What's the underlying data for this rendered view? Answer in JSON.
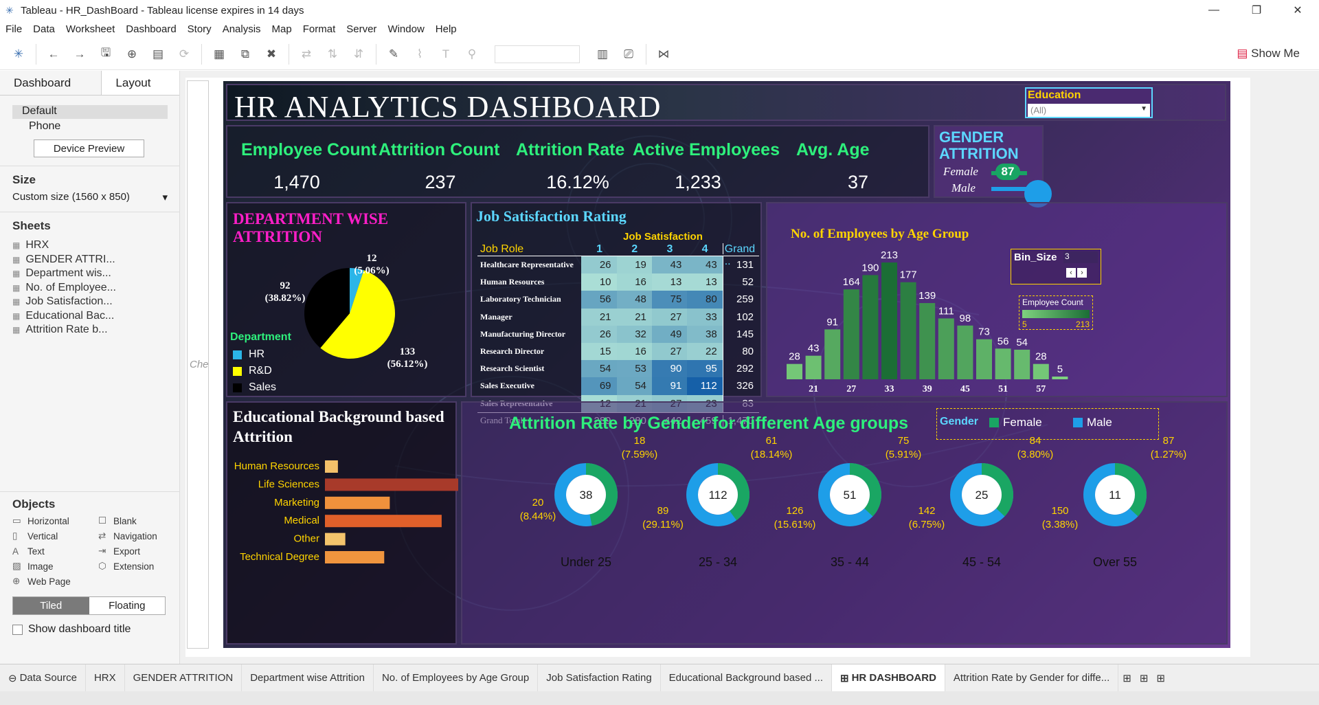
{
  "window": {
    "title": "Tableau - HR_DashBoard - Tableau license expires in 14 days"
  },
  "menu": [
    "File",
    "Data",
    "Worksheet",
    "Dashboard",
    "Story",
    "Analysis",
    "Map",
    "Format",
    "Server",
    "Window",
    "Help"
  ],
  "toolbar": {
    "show_me": "Show Me"
  },
  "sidebar": {
    "tabs": [
      "Dashboard",
      "Layout"
    ],
    "devices": [
      "Default",
      "Phone"
    ],
    "device_preview": "Device Preview",
    "size_label": "Size",
    "size_value": "Custom size (1560 x 850)",
    "sheets_label": "Sheets",
    "sheets": [
      "HRX",
      "GENDER ATTRI...",
      "Department wis...",
      "No. of Employee...",
      "Job Satisfaction...",
      "Educational Bac...",
      "Attrition Rate b..."
    ],
    "objects_label": "Objects",
    "objects": [
      "Horizontal",
      "Blank",
      "Vertical",
      "Navigation",
      "Text",
      "Export",
      "Image",
      "Extension",
      "Web Page"
    ],
    "tiled": "Tiled",
    "floating": "Floating",
    "show_title": "Show dashboard title"
  },
  "canvas_side_text": "Che",
  "dashboard": {
    "title": "HR ANALYTICS DASHBOARD",
    "filter": {
      "label": "Education",
      "value": "(All)"
    },
    "kpis": [
      {
        "label": "Employee Count",
        "value": "1,470"
      },
      {
        "label": "Attrition Count",
        "value": "237"
      },
      {
        "label": "Attrition Rate",
        "value": "16.12%"
      },
      {
        "label": "Active Employees",
        "value": "1,233"
      },
      {
        "label": "Avg. Age",
        "value": "37"
      }
    ],
    "gender_attrition": {
      "title_line1": "GENDER",
      "title_line2": "ATTRITION",
      "female_label": "Female",
      "male_label": "Male",
      "female_value": "87"
    },
    "department": {
      "title_line1": "DEPARTMENT WISE",
      "title_line2": "ATTRITION",
      "legend_title": "Department",
      "legend": [
        "HR",
        "R&D",
        "Sales"
      ],
      "labels": [
        {
          "v": "12",
          "p": "(5.06%)"
        },
        {
          "v": "133",
          "p": "(56.12%)"
        },
        {
          "v": "92",
          "p": "(38.82%)"
        }
      ]
    },
    "job_satisfaction": {
      "title": "Job Satisfaction Rating",
      "col_group": "Job Satisfaction",
      "row_header": "Job Role",
      "cols": [
        "1",
        "2",
        "3",
        "4",
        "Grand .."
      ],
      "rows": [
        {
          "role": "Healthcare Representative",
          "v": [
            "26",
            "19",
            "43",
            "43",
            "131"
          ]
        },
        {
          "role": "Human Resources",
          "v": [
            "10",
            "16",
            "13",
            "13",
            "52"
          ]
        },
        {
          "role": "Laboratory Technician",
          "v": [
            "56",
            "48",
            "75",
            "80",
            "259"
          ]
        },
        {
          "role": "Manager",
          "v": [
            "21",
            "21",
            "27",
            "33",
            "102"
          ]
        },
        {
          "role": "Manufacturing Director",
          "v": [
            "26",
            "32",
            "49",
            "38",
            "145"
          ]
        },
        {
          "role": "Research Director",
          "v": [
            "15",
            "16",
            "27",
            "22",
            "80"
          ]
        },
        {
          "role": "Research Scientist",
          "v": [
            "54",
            "53",
            "90",
            "95",
            "292"
          ]
        },
        {
          "role": "Sales Executive",
          "v": [
            "69",
            "54",
            "91",
            "112",
            "326"
          ]
        },
        {
          "role": "Sales Representative",
          "v": [
            "12",
            "21",
            "27",
            "23",
            "83"
          ]
        }
      ],
      "total": {
        "role": "Grand Total",
        "v": [
          "289",
          "280",
          "442",
          "459",
          "1,470"
        ]
      }
    },
    "age_group": {
      "title": "No. of Employees by Age Group",
      "bin_label": "Bin_Size",
      "bin_value": "3",
      "legend_title": "Employee Count",
      "legend_min": "5",
      "legend_max": "213"
    },
    "education": {
      "title_line1": "Educational Background based",
      "title_line2": "Attrition"
    },
    "gender_age": {
      "title": "Attrition Rate by Gender for different Age groups",
      "legend_title": "Gender",
      "legend": [
        "Female",
        "Male"
      ]
    }
  },
  "chart_data": [
    {
      "type": "pie",
      "title": "DEPARTMENT WISE ATTRITION",
      "categories": [
        "HR",
        "R&D",
        "Sales"
      ],
      "values": [
        12,
        133,
        92
      ],
      "percent": [
        5.06,
        56.12,
        38.82
      ],
      "colors": [
        "#2bb5e8",
        "#ffff00",
        "#000000"
      ]
    },
    {
      "type": "bar",
      "title": "No. of Employees by Age Group",
      "x": [
        "18",
        "21",
        "24",
        "27",
        "30",
        "33",
        "36",
        "39",
        "42",
        "45",
        "48",
        "51",
        "54",
        "57",
        "60"
      ],
      "values": [
        28,
        43,
        91,
        164,
        190,
        213,
        177,
        139,
        111,
        98,
        73,
        56,
        54,
        28,
        5
      ],
      "tick_labels": [
        "21",
        "27",
        "33",
        "39",
        "45",
        "51",
        "57"
      ],
      "ylim": [
        0,
        213
      ]
    },
    {
      "type": "bar",
      "title": "Educational Background based Attrition",
      "categories": [
        "Human Resources",
        "Life Sciences",
        "Marketing",
        "Medical",
        "Other",
        "Technical Degree"
      ],
      "values": [
        7,
        89,
        35,
        63,
        11,
        32
      ]
    },
    {
      "type": "pie",
      "title": "Attrition Rate by Gender for different Age groups",
      "groups": [
        {
          "age": "Under 25",
          "total": "38",
          "male": {
            "v": "20",
            "p": "(8.44%)"
          },
          "female": {
            "v": "18",
            "p": "(7.59%)"
          },
          "male_share": 0.53
        },
        {
          "age": "25 - 34",
          "total": "112",
          "male": {
            "v": "89",
            "p": "(29.11%)"
          },
          "female": {
            "v": "61",
            "p": "(18.14%)"
          },
          "male_share": 0.6
        },
        {
          "age": "35 - 44",
          "total": "51",
          "male": {
            "v": "126",
            "p": "(15.61%)"
          },
          "female": {
            "v": "75",
            "p": "(5.91%)"
          },
          "male_share": 0.63
        },
        {
          "age": "45 - 54",
          "total": "25",
          "male": {
            "v": "142",
            "p": "(6.75%)"
          },
          "female": {
            "v": "84",
            "p": "(3.80%)"
          },
          "male_share": 0.63
        },
        {
          "age": "Over 55",
          "total": "11",
          "male": {
            "v": "150",
            "p": "(3.38%)"
          },
          "female": {
            "v": "87",
            "p": "(1.27%)"
          },
          "male_share": 0.63
        }
      ],
      "colors": {
        "female": "#1aa663",
        "male": "#1e9ee8"
      }
    }
  ],
  "bottom_tabs": [
    "Data Source",
    "HRX",
    "GENDER ATTRITION",
    "Department wise Attrition",
    "No. of Employees by Age Group",
    "Job Satisfaction Rating",
    "Educational Background based ...",
    "HR DASHBOARD",
    "Attrition Rate by Gender for diffe..."
  ]
}
